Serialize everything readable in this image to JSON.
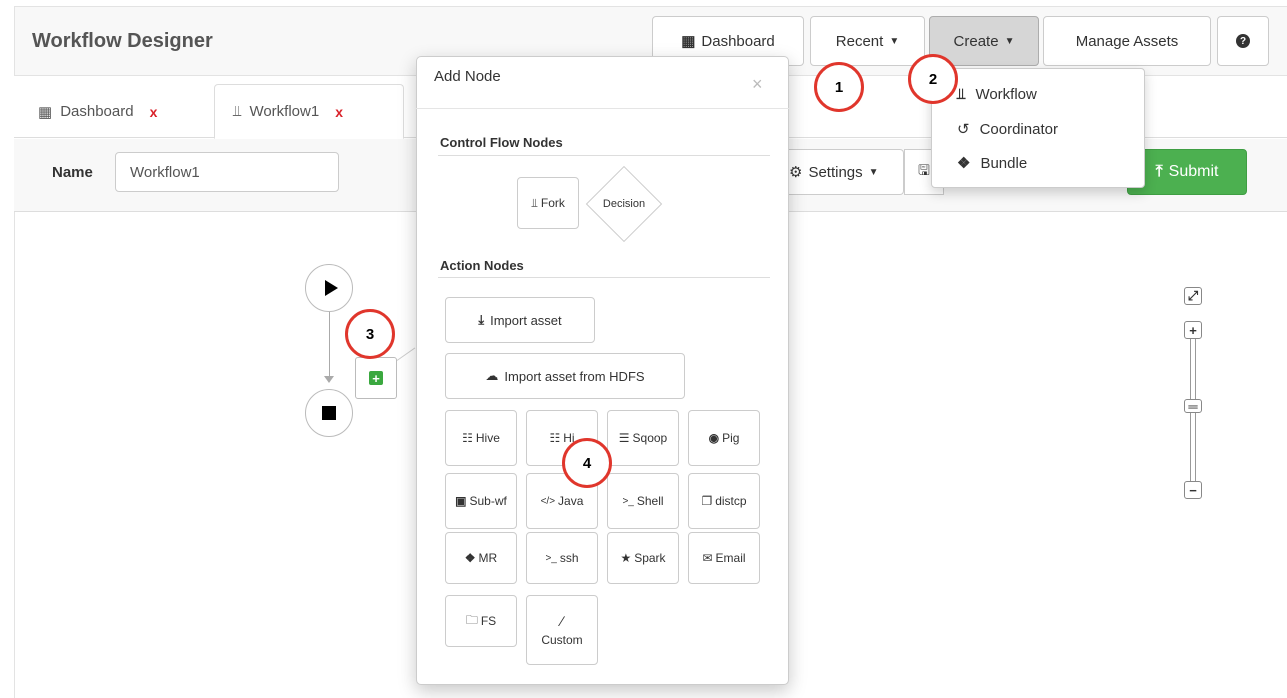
{
  "app": {
    "title": "Workflow Designer"
  },
  "nav": {
    "dashboard": "Dashboard",
    "recent": "Recent",
    "create": "Create",
    "manage_assets": "Manage Assets"
  },
  "tabs": [
    {
      "label": "Dashboard",
      "close": "x"
    },
    {
      "label": "Workflow1",
      "close": "x"
    }
  ],
  "toolbar": {
    "name_label": "Name",
    "name_value": "Workflow1",
    "settings": "Settings",
    "submit": "Submit"
  },
  "create_menu": {
    "items": [
      "Workflow",
      "Coordinator",
      "Bundle"
    ]
  },
  "add_node": {
    "title": "Add Node",
    "close": "×",
    "control_title": "Control Flow Nodes",
    "control": [
      "Fork",
      "Decision"
    ],
    "action_title": "Action Nodes",
    "import_asset": "Import asset",
    "import_hdfs": "Import asset from HDFS",
    "actions": [
      "Hive",
      "Hi",
      "Sqoop",
      "Pig",
      "Sub-wf",
      "Java",
      "Shell",
      "distcp",
      "MR",
      "ssh",
      "Spark",
      "Email",
      "FS",
      "Custom"
    ]
  },
  "callouts": [
    "1",
    "2",
    "3",
    "4"
  ],
  "colors": {
    "submit": "#4cb050",
    "callout": "#e0362c",
    "close_x": "#d9222a"
  }
}
